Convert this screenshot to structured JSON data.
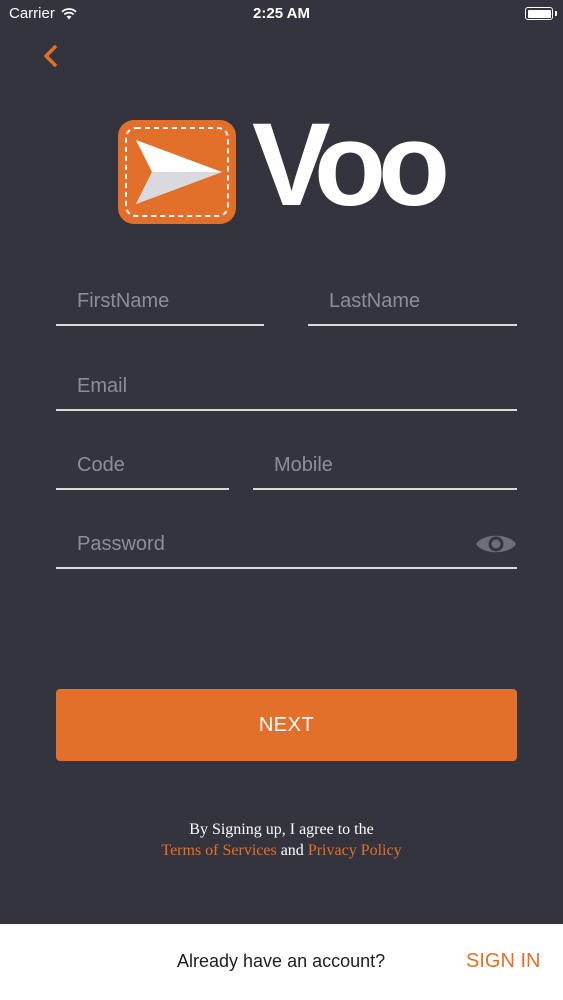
{
  "status_bar": {
    "carrier": "Carrier",
    "time": "2:25 AM"
  },
  "logo": {
    "text": "Voo"
  },
  "form": {
    "first_name_placeholder": "FirstName",
    "last_name_placeholder": "LastName",
    "email_placeholder": "Email",
    "code_placeholder": "Code",
    "mobile_placeholder": "Mobile",
    "password_placeholder": "Password"
  },
  "next_label": "NEXT",
  "terms": {
    "line1": "By Signing up, I agree to the",
    "terms_link": "Terms of Services",
    "and": "and",
    "privacy_link": "Privacy Policy"
  },
  "bottom": {
    "question": "Already have an account?",
    "signin_label": "SIGN IN"
  },
  "colors": {
    "accent": "#e2702a",
    "background": "#34343f",
    "line": "#d9d9de"
  }
}
